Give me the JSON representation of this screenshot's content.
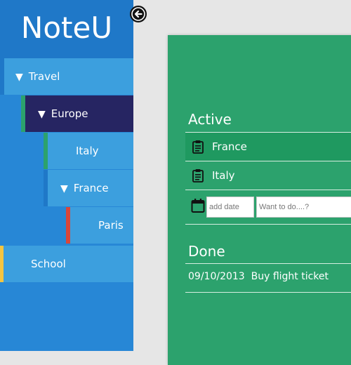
{
  "app": {
    "logo": "NoteU"
  },
  "tree": [
    {
      "label": "Travel",
      "expanded": true,
      "bar": "#1f78c8",
      "selected": false
    },
    {
      "label": "Europe",
      "expanded": true,
      "bar": "#2ca26d",
      "selected": true
    },
    {
      "label": "Italy",
      "expanded": false,
      "bar": "#2ca26d",
      "selected": false
    },
    {
      "label": "France",
      "expanded": true,
      "bar": "#1f78c8",
      "selected": false
    },
    {
      "label": "Paris",
      "expanded": false,
      "bar": "#d9463b",
      "selected": false
    },
    {
      "label": "School",
      "expanded": false,
      "bar": "#f4c542",
      "selected": false
    }
  ],
  "active": {
    "title": "Active",
    "items": [
      {
        "label": "France",
        "icon": "clipboard-icon",
        "highlighted": true
      },
      {
        "label": "Italy",
        "icon": "clipboard-icon",
        "highlighted": false
      }
    ],
    "add_date_placeholder": "add date",
    "todo_placeholder": "Want to do....?"
  },
  "done": {
    "title": "Done",
    "items": [
      {
        "date": "09/10/2013",
        "label": "Buy flight ticket"
      }
    ]
  },
  "colors": {
    "sidebar": "#2787d6",
    "logo_bg": "#1f78c8",
    "tree_item": "#3c9fde",
    "tree_selected": "#262562",
    "panel": "#2ca26d"
  }
}
